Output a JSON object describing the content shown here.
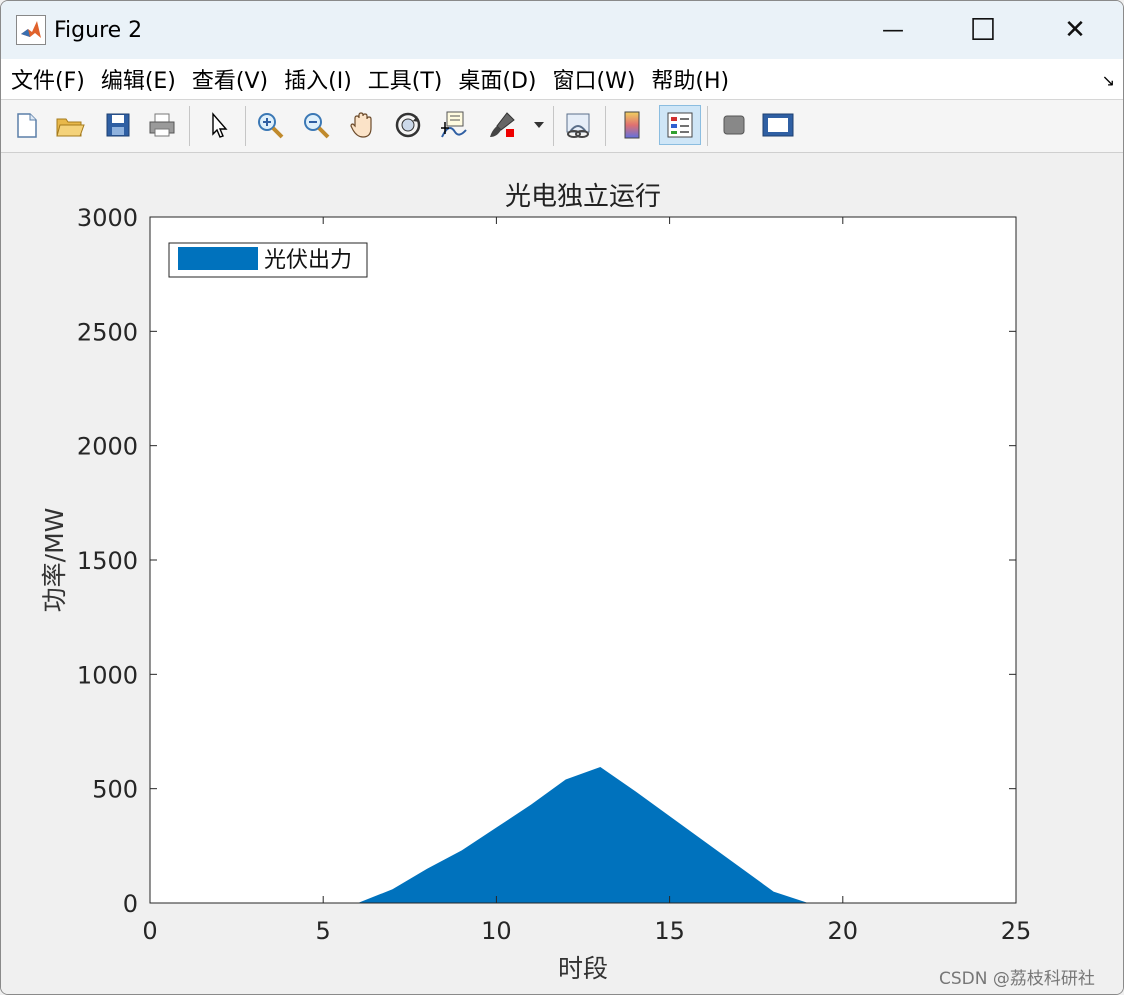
{
  "window": {
    "title": "Figure 2",
    "minimize_glyph": "—",
    "maximize_glyph": "☐",
    "close_glyph": "✕"
  },
  "menu": {
    "items": [
      "文件(F)",
      "编辑(E)",
      "查看(V)",
      "插入(I)",
      "工具(T)",
      "桌面(D)",
      "窗口(W)",
      "帮助(H)"
    ],
    "dock_glyph": "↘"
  },
  "toolbar": {
    "tools": [
      "new-figure-icon",
      "open-file-icon",
      "save-icon",
      "print-icon",
      "pointer-icon",
      "zoom-in-icon",
      "zoom-out-icon",
      "pan-hand-icon",
      "rotate-3d-icon",
      "data-cursor-icon",
      "brush-icon",
      "link-plot-icon",
      "colorbar-icon",
      "legend-icon",
      "hide-plot-tools-icon",
      "show-plot-tools-icon"
    ]
  },
  "watermark": "CSDN @荔枝科研社",
  "chart_data": {
    "type": "area",
    "title": "光电独立运行",
    "xlabel": "时段",
    "ylabel": "功率/MW",
    "xlim": [
      0,
      25
    ],
    "ylim": [
      0,
      3000
    ],
    "xticks": [
      0,
      5,
      10,
      15,
      20,
      25
    ],
    "yticks": [
      0,
      500,
      1000,
      1500,
      2000,
      2500,
      3000
    ],
    "grid": false,
    "legend_position": "top-left",
    "series": [
      {
        "name": "光伏出力",
        "color": "#0072bd",
        "x": [
          1,
          2,
          3,
          4,
          5,
          6,
          7,
          8,
          9,
          10,
          11,
          12,
          13,
          14,
          15,
          16,
          17,
          18,
          19,
          20,
          21,
          22,
          23,
          24
        ],
        "y": [
          0,
          0,
          0,
          0,
          0,
          0,
          60,
          150,
          230,
          330,
          430,
          540,
          595,
          490,
          380,
          270,
          160,
          50,
          0,
          0,
          0,
          0,
          0,
          0
        ]
      }
    ]
  }
}
